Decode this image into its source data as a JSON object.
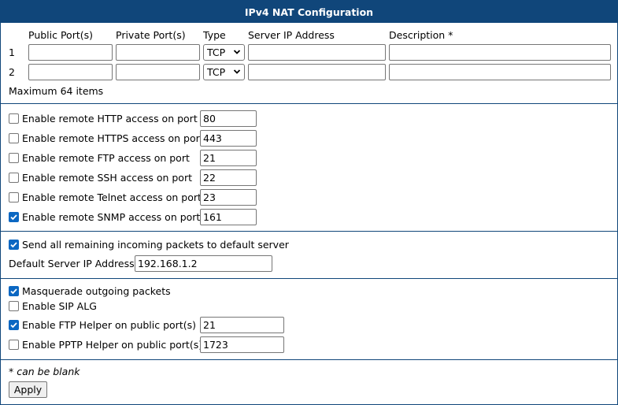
{
  "title": "IPv4 NAT Configuration",
  "table": {
    "headers": [
      "Public Port(s)",
      "Private Port(s)",
      "Type",
      "Server IP Address",
      "Description *"
    ],
    "rows": [
      {
        "index": "1",
        "public_port": "",
        "private_port": "",
        "type": "TCP",
        "server_ip": "",
        "description": ""
      },
      {
        "index": "2",
        "public_port": "",
        "private_port": "",
        "type": "TCP",
        "server_ip": "",
        "description": ""
      }
    ],
    "max_items": "Maximum 64 items"
  },
  "remote_access": [
    {
      "label": "Enable remote HTTP access on port",
      "checked": false,
      "port": "80"
    },
    {
      "label": "Enable remote HTTPS access on port",
      "checked": false,
      "port": "443"
    },
    {
      "label": "Enable remote FTP access on port",
      "checked": false,
      "port": "21"
    },
    {
      "label": "Enable remote SSH access on port",
      "checked": false,
      "port": "22"
    },
    {
      "label": "Enable remote Telnet access on port",
      "checked": false,
      "port": "23"
    },
    {
      "label": "Enable remote SNMP access on port",
      "checked": true,
      "port": "161"
    }
  ],
  "default_server": {
    "send_label": "Send all remaining incoming packets to default server",
    "send_checked": true,
    "ip_label": "Default Server IP Address",
    "ip_value": "192.168.1.2"
  },
  "helpers": {
    "masquerade": {
      "label": "Masquerade outgoing packets",
      "checked": true
    },
    "sip_alg": {
      "label": "Enable SIP ALG",
      "checked": false
    },
    "ftp_helper": {
      "label": "Enable FTP Helper on public port(s)",
      "checked": true,
      "value": "21"
    },
    "pptp_helper": {
      "label": "Enable PPTP Helper on public port(s)",
      "checked": false,
      "value": "1723"
    }
  },
  "footnote": "* can be blank",
  "apply_label": "Apply",
  "colors": {
    "header_bg": "#10467a",
    "checkbox_checked": "#0b67c2"
  },
  "icons": {
    "select_arrow": "chevron-down-icon",
    "checkbox_check": "check-icon"
  }
}
